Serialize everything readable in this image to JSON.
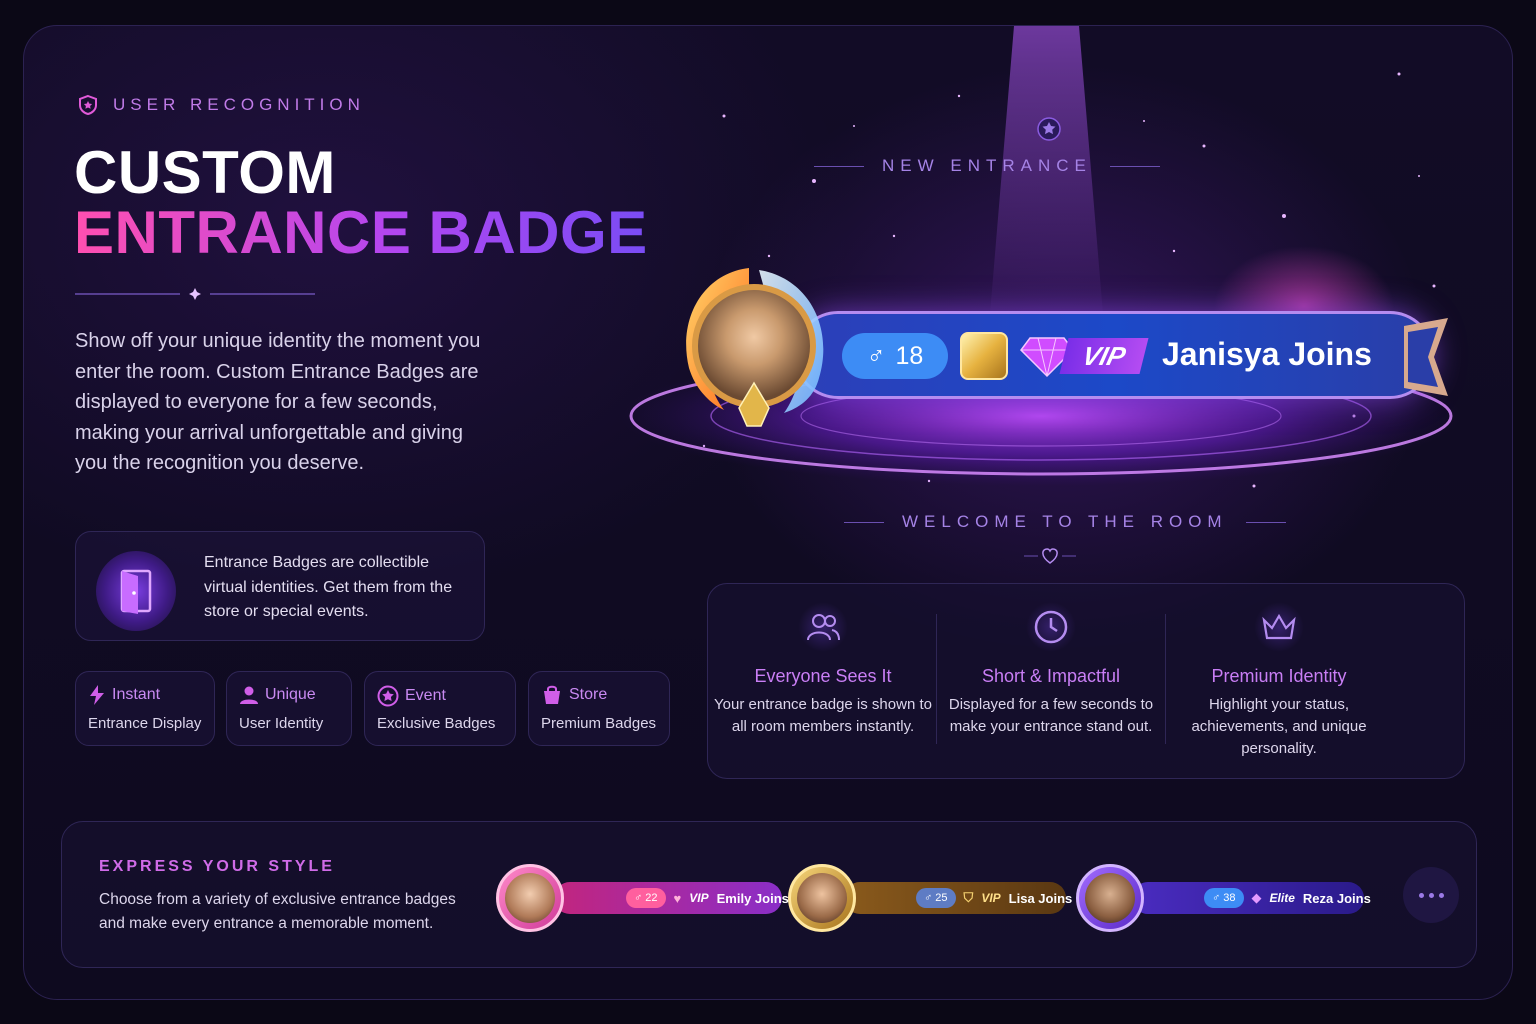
{
  "hero": {
    "eyebrow": "USER RECOGNITION",
    "title_line1": "CUSTOM",
    "title_line2": "ENTRANCE BADGE",
    "intro": "Show off your unique identity the moment you enter the room. Custom Entrance Badges are displayed to everyone for a few seconds, making your arrival unforgettable and giving you the recognition you deserve."
  },
  "info_box": {
    "icon": "door-icon",
    "text": "Entrance Badges are collectible virtual identities. Get them from the store or special events."
  },
  "chips": [
    {
      "icon": "lightning-icon",
      "title": "Instant",
      "subtitle": "Entrance Display"
    },
    {
      "icon": "user-icon",
      "title": "Unique",
      "subtitle": "User Identity"
    },
    {
      "icon": "star-badge-icon",
      "title": "Event",
      "subtitle": "Exclusive Badges"
    },
    {
      "icon": "shopping-bag-icon",
      "title": "Store",
      "subtitle": "Premium Badges"
    }
  ],
  "preview": {
    "top_label": "NEW ENTRANCE",
    "bottom_label": "WELCOME TO THE ROOM",
    "badge": {
      "gender_symbol": "♂",
      "age": "18",
      "vip": "VIP",
      "name_text": "Janisya Joins"
    }
  },
  "features": [
    {
      "icon": "users-icon",
      "title": "Everyone Sees It",
      "desc": "Your entrance badge is shown to all room members instantly."
    },
    {
      "icon": "clock-icon",
      "title": "Short & Impactful",
      "desc": "Displayed for a few seconds to make your entrance stand out."
    },
    {
      "icon": "crown-icon",
      "title": "Premium Identity",
      "desc": "Highlight your status, achievements, and unique personality."
    }
  ],
  "express": {
    "heading": "EXPRESS YOUR STYLE",
    "desc": "Choose from a variety of exclusive entrance badges and make every entrance a memorable moment.",
    "samples": [
      {
        "age": "♂ 22",
        "tier": "VIP",
        "name": "Emily Joins"
      },
      {
        "age": "♂ 25",
        "tier": "VIP",
        "name": "Lisa Joins"
      },
      {
        "age": "♂ 38",
        "tier": "Elite",
        "name": "Reza Joins"
      }
    ]
  },
  "colors": {
    "accent_pink": "#ff4fb0",
    "accent_purple": "#b346f0",
    "badge_blue": "#1c49c8",
    "background": "#0e0a1f"
  }
}
